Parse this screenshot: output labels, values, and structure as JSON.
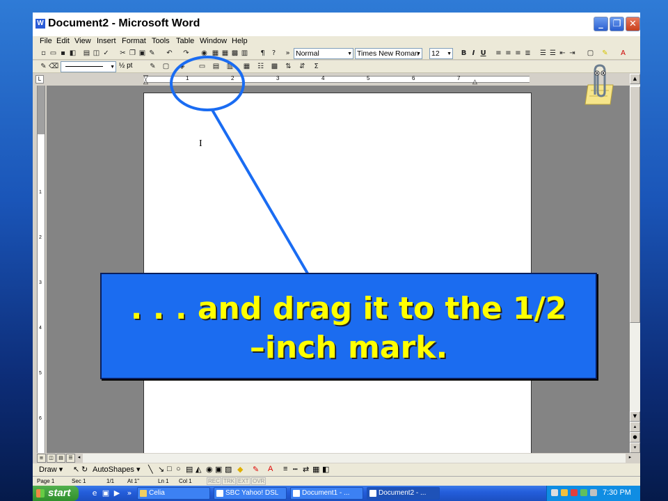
{
  "window": {
    "title": "Document2 - Microsoft Word",
    "app_icon": "W",
    "controls": {
      "minimize": "_",
      "maximize": "❐",
      "close": "✕"
    }
  },
  "menubar": [
    "File",
    "Edit",
    "View",
    "Insert",
    "Format",
    "Tools",
    "Table",
    "Window",
    "Help"
  ],
  "toolbar_standard": {
    "icons": [
      "new-icon",
      "open-icon",
      "save-icon",
      "permission-icon",
      "print-icon",
      "print-preview-icon",
      "spelling-icon",
      "cut-icon",
      "copy-icon",
      "paste-icon",
      "format-painter-icon",
      "undo-icon",
      "redo-icon",
      "hyperlink-icon",
      "tables-borders-icon",
      "insert-table-icon",
      "insert-excel-icon",
      "columns-icon",
      "show-hide-icon"
    ],
    "more": "»"
  },
  "toolbar_formatting": {
    "style": "Normal",
    "font": "Times New Roman",
    "size": "12",
    "bold": "B",
    "italic": "I",
    "underline": "U",
    "align": [
      "align-left-icon",
      "center-icon",
      "align-right-icon",
      "justify-icon"
    ],
    "lists": [
      "numbering-icon",
      "bullets-icon",
      "decrease-indent-icon",
      "increase-indent-icon"
    ]
  },
  "toolbar_tables": {
    "line_weight": "½ pt",
    "icons": [
      "pencil-icon",
      "eraser-icon",
      "border-icon",
      "shading-icon",
      "insert-table-icon",
      "merge-cells-icon",
      "split-cells-icon",
      "align-icon",
      "sort-icon",
      "autosum-icon"
    ]
  },
  "ruler": {
    "numbers": [
      "1",
      "2",
      "3",
      "4",
      "5",
      "6",
      "7"
    ],
    "vertical_numbers": [
      "1",
      "2",
      "3",
      "4",
      "5",
      "6"
    ]
  },
  "document": {
    "cursor": "I"
  },
  "drawbar": {
    "draw": "Draw ▾",
    "autoshapes": "AutoShapes ▾"
  },
  "statusbar": {
    "page": "Page 1",
    "sec": "Sec 1",
    "pages": "1/1",
    "at": "At 1\"",
    "ln": "Ln 1",
    "col": "Col 1",
    "rec": "REC",
    "trk": "TRK",
    "ext": "EXT",
    "ovr": "OVR"
  },
  "taskbar": {
    "start": "start",
    "buttons": [
      "Celia",
      "SBC Yahoo! DSL",
      "Document1 - ...",
      "Document2 - ..."
    ],
    "clock": "7:30 PM",
    "more": "»"
  },
  "callout": {
    "line1": ". . . and drag it to the 1/2",
    "line2": "–inch mark."
  },
  "colors": {
    "callout_bg": "#1b6cf0",
    "callout_text": "#ffff00",
    "highlight_ring": "#1a6cf2"
  }
}
